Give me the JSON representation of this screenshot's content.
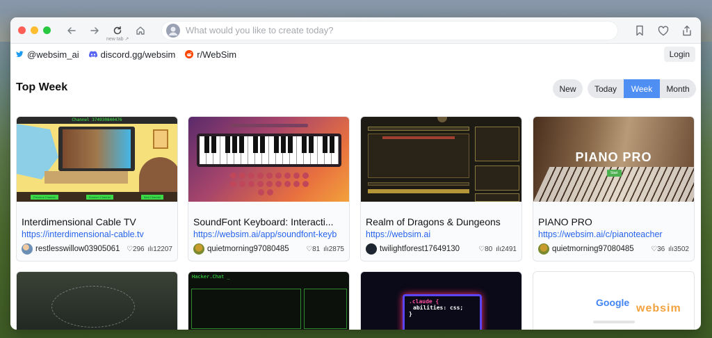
{
  "browser": {
    "new_tab_label": "new tab ↗",
    "address_placeholder": "What would you like to create today?"
  },
  "social": [
    {
      "label": "@websim_ai",
      "icon": "twitter-icon"
    },
    {
      "label": "discord.gg/websim",
      "icon": "discord-icon"
    },
    {
      "label": "r/WebSim",
      "icon": "reddit-icon"
    }
  ],
  "login_label": "Login",
  "page_title": "Top Week",
  "filters": {
    "new": "New",
    "periods": [
      "Today",
      "Week",
      "Month"
    ],
    "active_period": "Week"
  },
  "thumbnails": {
    "card1_channel": "Channel 374930840476",
    "card1_buttons": [
      "Previous Channel",
      "Random Channel",
      "Next Channel"
    ],
    "card4_heading": "PIANO PRO",
    "card4_button": "Start",
    "card6_title": "Hacker.Chat _",
    "card7_code_line1": ".claude {",
    "card7_code_line2": "abilities: css;",
    "card7_code_line3": "}",
    "card8_logo_a": "Google",
    "card8_logo_b": "websim"
  },
  "cards": [
    {
      "title": "Interdimensional Cable TV",
      "url": "https://interdimensional-cable.tv",
      "user": "restlesswillow03905061",
      "likes": "296",
      "views": "12207"
    },
    {
      "title": "SoundFont Keyboard: Interacti...",
      "url": "https://websim.ai/app/soundfont-keyb",
      "user": "quietmorning97080485",
      "likes": "81",
      "views": "2875"
    },
    {
      "title": "Realm of Dragons & Dungeons",
      "url": "https://websim.ai",
      "user": "twilightforest17649130",
      "likes": "80",
      "views": "2491"
    },
    {
      "title": "PIANO PRO",
      "url": "https://websim.ai/c/pianoteacher",
      "user": "quietmorning97080485",
      "likes": "36",
      "views": "3502"
    }
  ],
  "colors": {
    "accent": "#4f8ef2",
    "link": "#2563eb",
    "traffic_red": "#ff5f57",
    "traffic_yellow": "#febc2e",
    "traffic_green": "#28c840"
  }
}
